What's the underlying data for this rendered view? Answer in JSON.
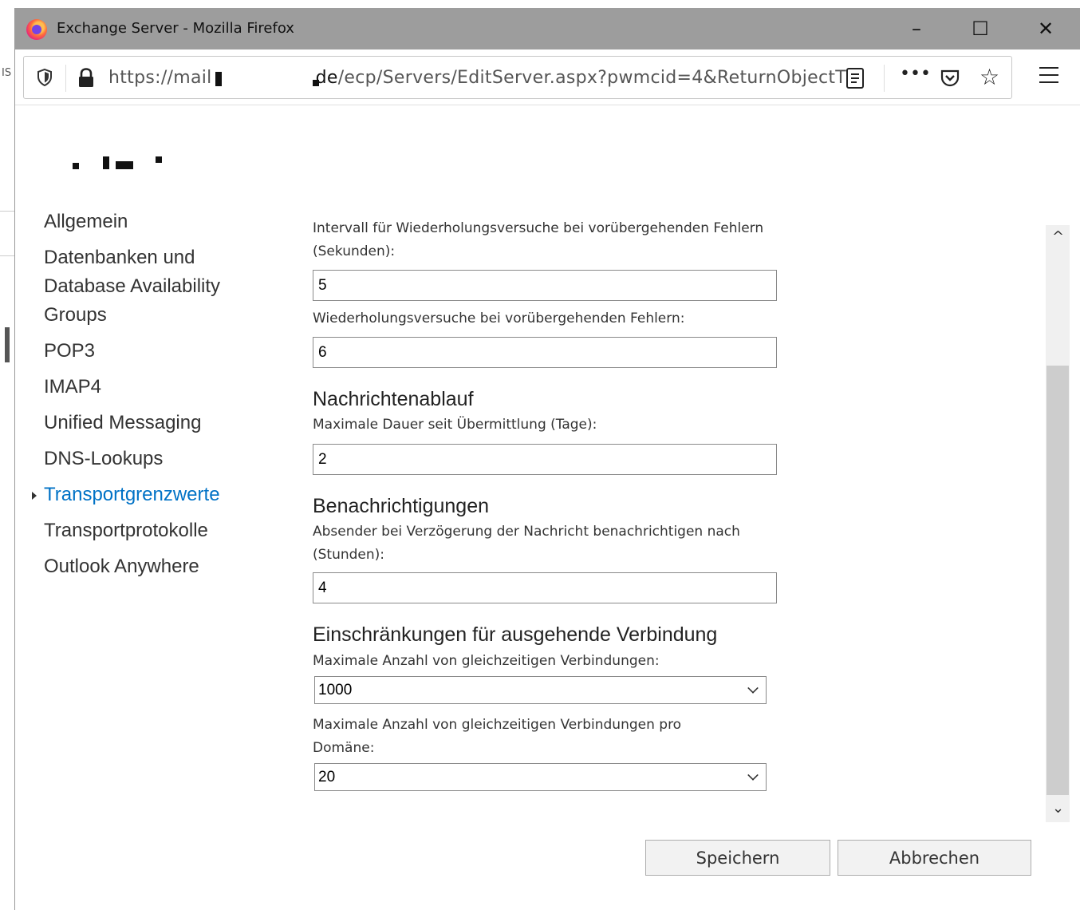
{
  "window": {
    "title": "Exchange Server - Mozilla Firefox",
    "minimize": "–",
    "maximize": "☐",
    "close": "✕"
  },
  "background": {
    "edge_text": "IS"
  },
  "urlbar": {
    "url_prefix": "https://mail",
    "url_host": "de",
    "url_suffix": "/ecp/Servers/EditServer.aspx?pwmcid=4&ReturnObjectT",
    "more": "•••",
    "star": "☆"
  },
  "nav": {
    "items": [
      {
        "label": "Allgemein"
      },
      {
        "label": "Datenbanken und Database Availability Groups"
      },
      {
        "label": "POP3"
      },
      {
        "label": "IMAP4"
      },
      {
        "label": "Unified Messaging"
      },
      {
        "label": "DNS-Lookups"
      },
      {
        "label": "Transportgrenzwerte",
        "active": true
      },
      {
        "label": "Transportprotokolle"
      },
      {
        "label": "Outlook Anywhere"
      }
    ]
  },
  "form": {
    "retry_interval_label": "Intervall für Wiederholungsversuche bei vorübergehenden Fehlern (Sekunden):",
    "retry_interval_value": "5",
    "retry_count_label": "Wiederholungsversuche bei vorübergehenden Fehlern:",
    "retry_count_value": "6",
    "expiry_section": "Nachrichtenablauf",
    "expiry_label": "Maximale Dauer seit Übermittlung (Tage):",
    "expiry_value": "2",
    "notify_section": "Benachrichtigungen",
    "notify_label": "Absender bei Verzögerung der Nachricht benachrichtigen nach (Stunden):",
    "notify_value": "4",
    "outbound_section": "Einschränkungen für ausgehende Verbindung",
    "max_conn_label": "Maximale Anzahl von gleichzeitigen Verbindungen:",
    "max_conn_value": "1000",
    "max_conn_domain_label": "Maximale Anzahl von gleichzeitigen Verbindungen pro Domäne:",
    "max_conn_domain_value": "20"
  },
  "scrollbar": {
    "up": "^",
    "down": "⌄"
  },
  "buttons": {
    "save": "Speichern",
    "cancel": "Abbrechen"
  },
  "colors": {
    "accent": "#0072c6",
    "titlebar": "#9d9d9d"
  }
}
